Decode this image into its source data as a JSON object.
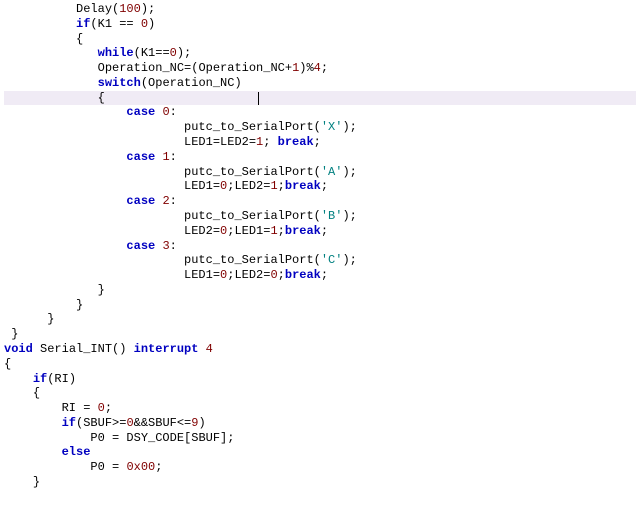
{
  "code_lines": [
    {
      "indent": "          ",
      "segments": [
        {
          "t": "Delay",
          "c": "fn"
        },
        {
          "t": "(",
          "c": "op"
        },
        {
          "t": "100",
          "c": "num"
        },
        {
          "t": ");",
          "c": "op"
        }
      ]
    },
    {
      "indent": "          ",
      "segments": [
        {
          "t": "if",
          "c": "kw"
        },
        {
          "t": "(K1 == ",
          "c": "op"
        },
        {
          "t": "0",
          "c": "num"
        },
        {
          "t": ")",
          "c": "op"
        }
      ]
    },
    {
      "indent": "          ",
      "segments": [
        {
          "t": "{",
          "c": "op"
        }
      ]
    },
    {
      "indent": "             ",
      "segments": [
        {
          "t": "while",
          "c": "kw"
        },
        {
          "t": "(K1==",
          "c": "op"
        },
        {
          "t": "0",
          "c": "num"
        },
        {
          "t": ");",
          "c": "op"
        }
      ]
    },
    {
      "indent": "             ",
      "segments": [
        {
          "t": "Operation_NC=(Operation_NC+",
          "c": "id"
        },
        {
          "t": "1",
          "c": "num"
        },
        {
          "t": ")%",
          "c": "op"
        },
        {
          "t": "4",
          "c": "num"
        },
        {
          "t": ";",
          "c": "op"
        }
      ]
    },
    {
      "indent": "             ",
      "segments": [
        {
          "t": "switch",
          "c": "kw"
        },
        {
          "t": "(Operation_NC)",
          "c": "op"
        }
      ]
    },
    {
      "indent": "             ",
      "highlighted": true,
      "caret": true,
      "segments": [
        {
          "t": "{",
          "c": "op"
        }
      ]
    },
    {
      "indent": "                 ",
      "segments": [
        {
          "t": "case",
          "c": "kw"
        },
        {
          "t": " ",
          "c": "op"
        },
        {
          "t": "0",
          "c": "num"
        },
        {
          "t": ":",
          "c": "op"
        }
      ]
    },
    {
      "indent": "                         ",
      "segments": [
        {
          "t": "putc_to_SerialPort(",
          "c": "fn"
        },
        {
          "t": "'X'",
          "c": "str"
        },
        {
          "t": ");",
          "c": "op"
        }
      ]
    },
    {
      "indent": "                         ",
      "segments": [
        {
          "t": "LED1=LED2=",
          "c": "id"
        },
        {
          "t": "1",
          "c": "num"
        },
        {
          "t": "; ",
          "c": "op"
        },
        {
          "t": "break",
          "c": "kw"
        },
        {
          "t": ";",
          "c": "op"
        }
      ]
    },
    {
      "indent": "                 ",
      "segments": [
        {
          "t": "case",
          "c": "kw"
        },
        {
          "t": " ",
          "c": "op"
        },
        {
          "t": "1",
          "c": "num"
        },
        {
          "t": ":",
          "c": "op"
        }
      ]
    },
    {
      "indent": "                         ",
      "segments": [
        {
          "t": "putc_to_SerialPort(",
          "c": "fn"
        },
        {
          "t": "'A'",
          "c": "str"
        },
        {
          "t": ");",
          "c": "op"
        }
      ]
    },
    {
      "indent": "                         ",
      "segments": [
        {
          "t": "LED1=",
          "c": "id"
        },
        {
          "t": "0",
          "c": "num"
        },
        {
          "t": ";LED2=",
          "c": "id"
        },
        {
          "t": "1",
          "c": "num"
        },
        {
          "t": ";",
          "c": "op"
        },
        {
          "t": "break",
          "c": "kw"
        },
        {
          "t": ";",
          "c": "op"
        }
      ]
    },
    {
      "indent": "                 ",
      "segments": [
        {
          "t": "case",
          "c": "kw"
        },
        {
          "t": " ",
          "c": "op"
        },
        {
          "t": "2",
          "c": "num"
        },
        {
          "t": ":",
          "c": "op"
        }
      ]
    },
    {
      "indent": "                         ",
      "segments": [
        {
          "t": "putc_to_SerialPort(",
          "c": "fn"
        },
        {
          "t": "'B'",
          "c": "str"
        },
        {
          "t": ");",
          "c": "op"
        }
      ]
    },
    {
      "indent": "                         ",
      "segments": [
        {
          "t": "LED2=",
          "c": "id"
        },
        {
          "t": "0",
          "c": "num"
        },
        {
          "t": ";LED1=",
          "c": "id"
        },
        {
          "t": "1",
          "c": "num"
        },
        {
          "t": ";",
          "c": "op"
        },
        {
          "t": "break",
          "c": "kw"
        },
        {
          "t": ";",
          "c": "op"
        }
      ]
    },
    {
      "indent": "                 ",
      "segments": [
        {
          "t": "case",
          "c": "kw"
        },
        {
          "t": " ",
          "c": "op"
        },
        {
          "t": "3",
          "c": "num"
        },
        {
          "t": ":",
          "c": "op"
        }
      ]
    },
    {
      "indent": "                         ",
      "segments": [
        {
          "t": "putc_to_SerialPort(",
          "c": "fn"
        },
        {
          "t": "'C'",
          "c": "str"
        },
        {
          "t": ");",
          "c": "op"
        }
      ]
    },
    {
      "indent": "                         ",
      "segments": [
        {
          "t": "LED1=",
          "c": "id"
        },
        {
          "t": "0",
          "c": "num"
        },
        {
          "t": ";LED2=",
          "c": "id"
        },
        {
          "t": "0",
          "c": "num"
        },
        {
          "t": ";",
          "c": "op"
        },
        {
          "t": "break",
          "c": "kw"
        },
        {
          "t": ";",
          "c": "op"
        }
      ]
    },
    {
      "indent": "             ",
      "segments": [
        {
          "t": "}",
          "c": "op"
        }
      ]
    },
    {
      "indent": "          ",
      "segments": [
        {
          "t": "}",
          "c": "op"
        }
      ]
    },
    {
      "indent": "      ",
      "segments": [
        {
          "t": "}",
          "c": "op"
        }
      ]
    },
    {
      "indent": " ",
      "segments": [
        {
          "t": "}",
          "c": "op"
        }
      ]
    },
    {
      "indent": "",
      "segments": []
    },
    {
      "indent": "",
      "segments": [
        {
          "t": "void",
          "c": "kw"
        },
        {
          "t": " Serial_INT() ",
          "c": "fn"
        },
        {
          "t": "interrupt",
          "c": "kw"
        },
        {
          "t": " ",
          "c": "op"
        },
        {
          "t": "4",
          "c": "num"
        }
      ]
    },
    {
      "indent": "",
      "segments": [
        {
          "t": "{",
          "c": "op"
        }
      ]
    },
    {
      "indent": "    ",
      "segments": [
        {
          "t": "if",
          "c": "kw"
        },
        {
          "t": "(RI)",
          "c": "op"
        }
      ]
    },
    {
      "indent": "    ",
      "segments": [
        {
          "t": "{",
          "c": "op"
        }
      ]
    },
    {
      "indent": "        ",
      "segments": [
        {
          "t": "RI = ",
          "c": "id"
        },
        {
          "t": "0",
          "c": "num"
        },
        {
          "t": ";",
          "c": "op"
        }
      ]
    },
    {
      "indent": "        ",
      "segments": [
        {
          "t": "if",
          "c": "kw"
        },
        {
          "t": "(SBUF>=",
          "c": "op"
        },
        {
          "t": "0",
          "c": "num"
        },
        {
          "t": "&&SBUF<=",
          "c": "op"
        },
        {
          "t": "9",
          "c": "num"
        },
        {
          "t": ")",
          "c": "op"
        }
      ]
    },
    {
      "indent": "            ",
      "segments": [
        {
          "t": "P0 = DSY_CODE[SBUF];",
          "c": "id"
        }
      ]
    },
    {
      "indent": "        ",
      "segments": [
        {
          "t": "else",
          "c": "kw"
        }
      ]
    },
    {
      "indent": "            ",
      "segments": [
        {
          "t": "P0 = ",
          "c": "id"
        },
        {
          "t": "0x00",
          "c": "num"
        },
        {
          "t": ";",
          "c": "op"
        }
      ]
    },
    {
      "indent": "    ",
      "segments": [
        {
          "t": "}",
          "c": "op"
        }
      ]
    }
  ]
}
